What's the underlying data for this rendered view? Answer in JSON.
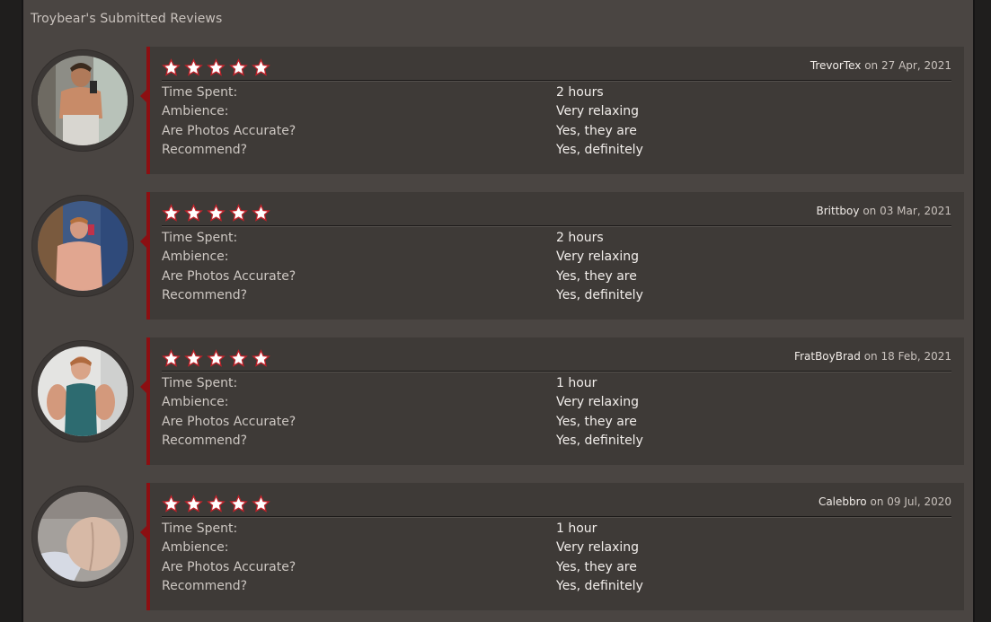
{
  "section_title": "Troybear's Submitted Reviews",
  "labels": {
    "time_spent": "Time Spent:",
    "ambience": "Ambience:",
    "photos_accurate": "Are Photos Accurate?",
    "recommend": "Recommend?",
    "on": "on"
  },
  "colors": {
    "accent": "#8c0f12",
    "star_fill": "#ffffff",
    "star_outline": "#c0222a"
  },
  "reviews": [
    {
      "user": "TrevorTex",
      "date": "27 Apr, 2021",
      "rating": 5,
      "time_spent": "2 hours",
      "ambience": "Very relaxing",
      "photos_accurate": "Yes, they are",
      "recommend": "Yes, definitely"
    },
    {
      "user": "Brittboy",
      "date": "03 Mar, 2021",
      "rating": 5,
      "time_spent": "2 hours",
      "ambience": "Very relaxing",
      "photos_accurate": "Yes, they are",
      "recommend": "Yes, definitely"
    },
    {
      "user": "FratBoyBrad",
      "date": "18 Feb, 2021",
      "rating": 5,
      "time_spent": "1 hour",
      "ambience": "Very relaxing",
      "photos_accurate": "Yes, they are",
      "recommend": "Yes, definitely"
    },
    {
      "user": "Calebbro",
      "date": "09 Jul, 2020",
      "rating": 5,
      "time_spent": "1 hour",
      "ambience": "Very relaxing",
      "photos_accurate": "Yes, they are",
      "recommend": "Yes, definitely"
    }
  ]
}
